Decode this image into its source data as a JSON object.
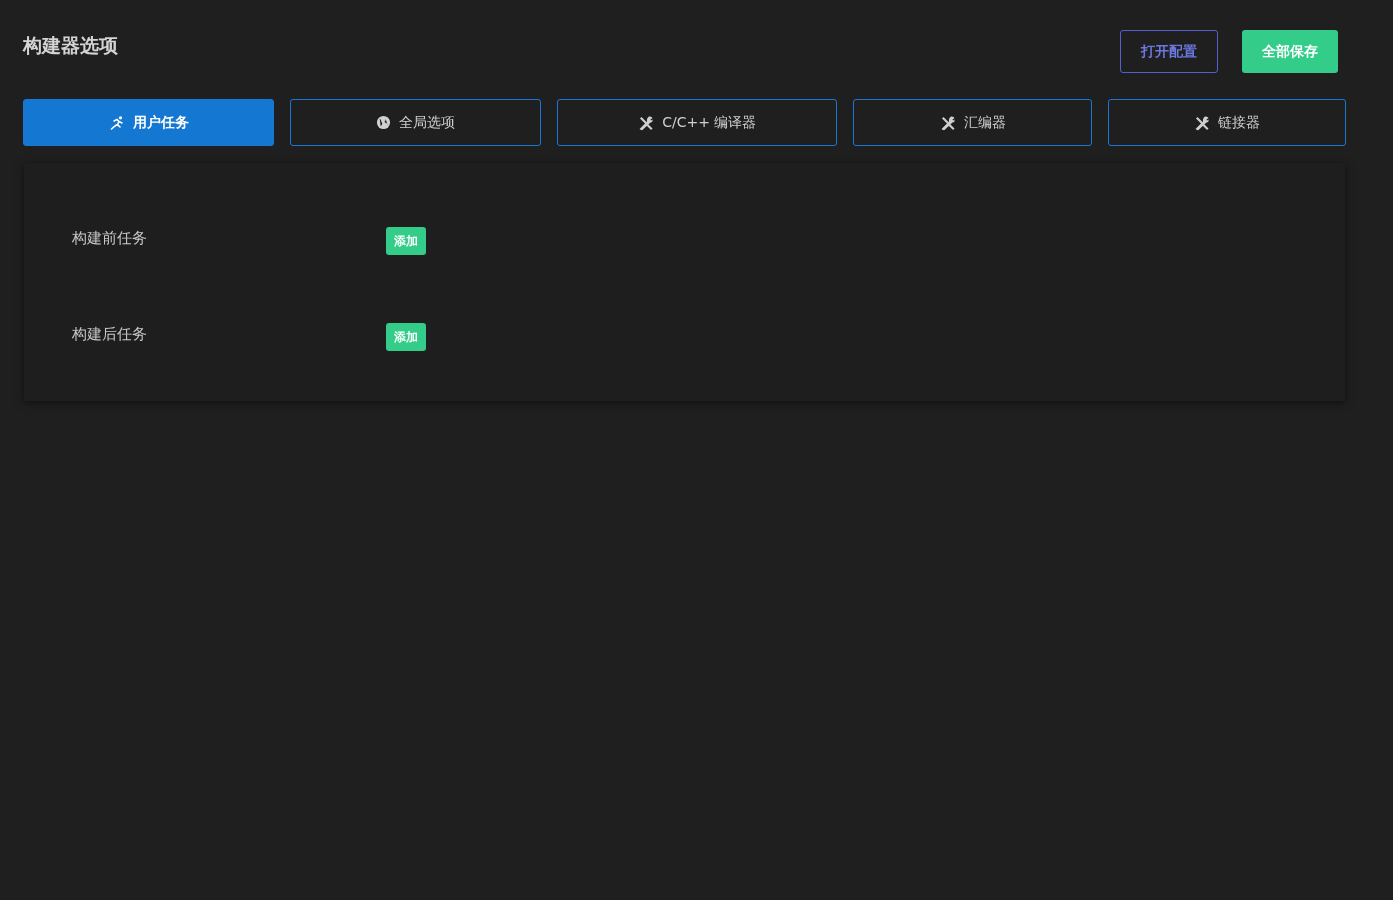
{
  "title": "构建器选项",
  "actions": [
    {
      "label": "打开配置",
      "kind": "outline"
    },
    {
      "label": "全部保存",
      "kind": "primary"
    }
  ],
  "tabs": [
    {
      "label": "用户任务",
      "kind": "run",
      "selected": true
    },
    {
      "label": "全局选项",
      "kind": "globe",
      "selected": false
    },
    {
      "label": "C/C++ 编译器",
      "kind": "tools",
      "selected": false
    },
    {
      "label": "汇编器",
      "kind": "tools",
      "selected": false
    },
    {
      "label": "链接器",
      "kind": "tools",
      "selected": false
    }
  ],
  "tasks": [
    {
      "label": "构建前任务",
      "button": "添加"
    },
    {
      "label": "构建后任务",
      "button": "添加"
    }
  ]
}
